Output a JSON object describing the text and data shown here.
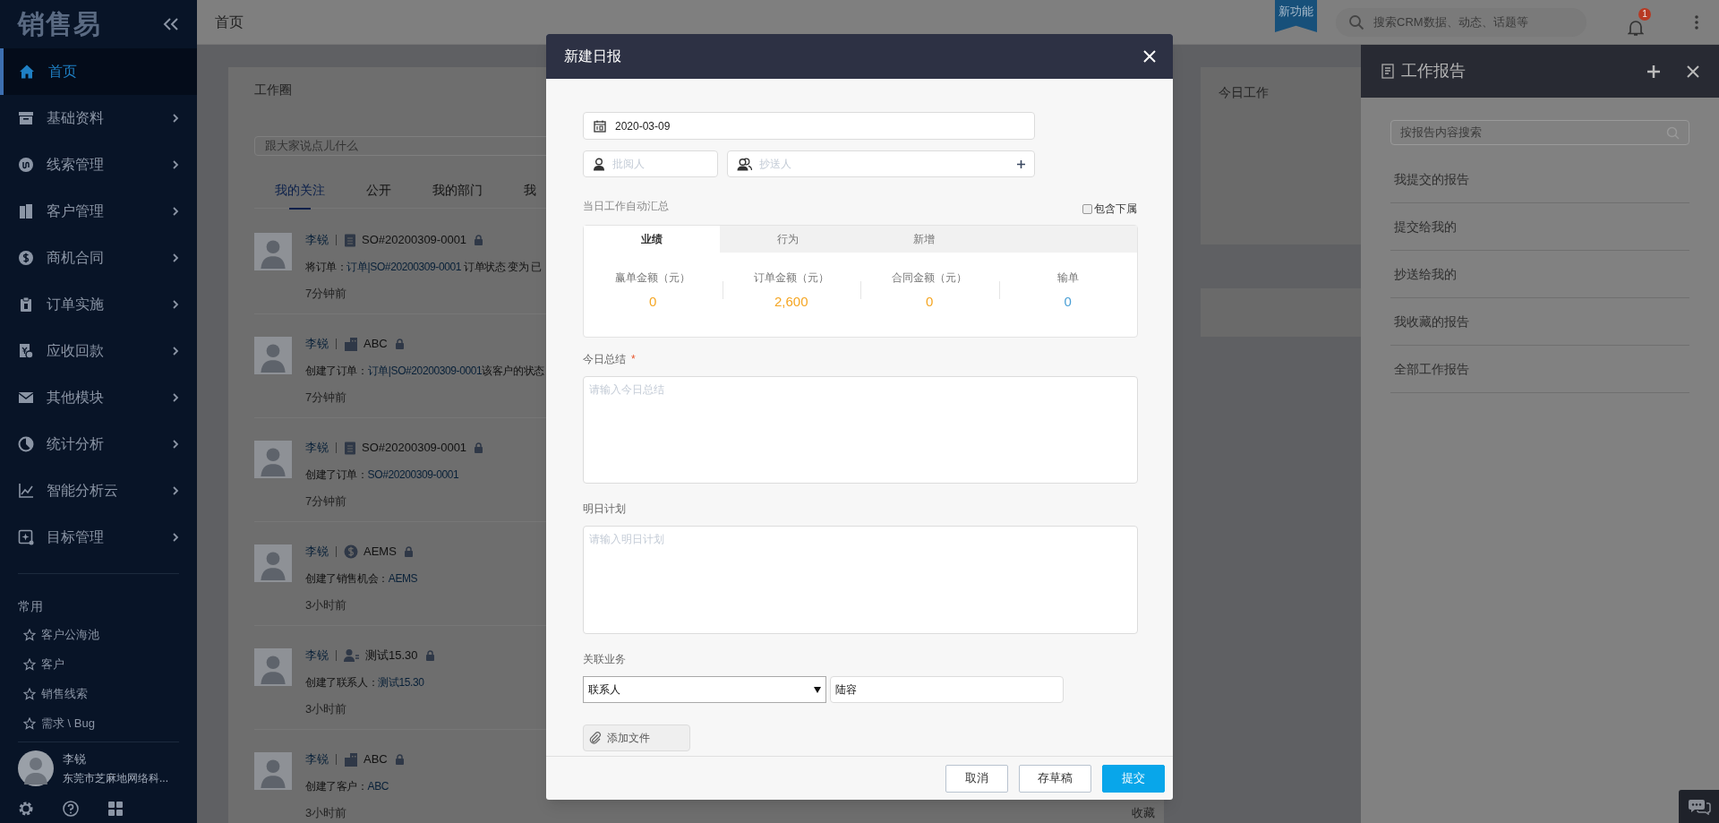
{
  "sidebar": {
    "logo": "销售易",
    "nav": [
      {
        "label": "首页",
        "selected": true,
        "has_submenu": false
      },
      {
        "label": "基础资料",
        "selected": false,
        "has_submenu": true
      },
      {
        "label": "线索管理",
        "selected": false,
        "has_submenu": true
      },
      {
        "label": "客户管理",
        "selected": false,
        "has_submenu": true
      },
      {
        "label": "商机合同",
        "selected": false,
        "has_submenu": true
      },
      {
        "label": "订单实施",
        "selected": false,
        "has_submenu": true
      },
      {
        "label": "应收回款",
        "selected": false,
        "has_submenu": true
      },
      {
        "label": "其他模块",
        "selected": false,
        "has_submenu": true
      },
      {
        "label": "统计分析",
        "selected": false,
        "has_submenu": true
      },
      {
        "label": "智能分析云",
        "selected": false,
        "has_submenu": true
      },
      {
        "label": "目标管理",
        "selected": false,
        "has_submenu": true
      }
    ],
    "favorites_title": "常用",
    "favorites": [
      "客户公海池",
      "客户",
      "销售线索",
      "需求 \\ Bug"
    ],
    "user": {
      "name": "李锐",
      "company": "东莞市芝麻地网络科..."
    }
  },
  "topbar": {
    "title": "首页",
    "ribbon": "新功能",
    "search_placeholder": "搜索CRM数据、动态、话题等",
    "notification_count": "1"
  },
  "feed": {
    "title": "工作圈",
    "composer_placeholder": "跟大家说点儿什么",
    "tabs": [
      {
        "label": "我的关注",
        "selected": true
      },
      {
        "label": "公开",
        "selected": false
      },
      {
        "label": "我的部门",
        "selected": false
      },
      {
        "label": "我",
        "selected": false
      }
    ],
    "posts": [
      {
        "author": "李锐",
        "kind": "order",
        "object": "SO#20200309-0001",
        "locked": true,
        "action": "将订单：",
        "link": "订单|SO#20200309-0001",
        "tail": " 订单状态 变为 已",
        "time": "7分钟前"
      },
      {
        "author": "李锐",
        "kind": "customer",
        "object": "ABC",
        "locked": true,
        "action": "创建了订单：",
        "link": "订单|SO#20200309-0001",
        "tail": "该客户的状态",
        "time": "7分钟前"
      },
      {
        "author": "李锐",
        "kind": "order",
        "object": "SO#20200309-0001",
        "locked": true,
        "action": "创建了订单：",
        "link": "SO#20200309-0001",
        "time": "7分钟前"
      },
      {
        "author": "李锐",
        "kind": "opportunity",
        "object": "AEMS",
        "locked": true,
        "action": "创建了销售机会：",
        "link": "AEMS",
        "time": "3小时前"
      },
      {
        "author": "李锐",
        "kind": "contact",
        "object": "测试15.30",
        "locked": true,
        "action": "创建了联系人：",
        "link": "测试15.30",
        "time": "3小时前"
      },
      {
        "author": "李锐",
        "kind": "customer",
        "object": "ABC",
        "locked": true,
        "action": "创建了客户：",
        "link": "ABC",
        "time": "3小时前",
        "favorite": "收藏"
      }
    ]
  },
  "today_card": {
    "title": "今日工作"
  },
  "dialog": {
    "title": "新建日报",
    "date": "2020-03-09",
    "reviewer_placeholder": "批阅人",
    "cc_placeholder": "抄送人",
    "summary_label": "当日工作自动汇总",
    "include_subordinates": {
      "label": "包含下属",
      "checked": false
    },
    "summary_tabs": [
      {
        "label": "业绩",
        "selected": true
      },
      {
        "label": "行为",
        "selected": false
      },
      {
        "label": "新增",
        "selected": false
      }
    ],
    "stats": [
      {
        "label": "赢单金额（元）",
        "value": "0",
        "color": "#f5a623"
      },
      {
        "label": "订单金额（元）",
        "value": "2,600",
        "color": "#f5a623"
      },
      {
        "label": "合同金额（元）",
        "value": "0",
        "color": "#f5a623"
      },
      {
        "label": "输单",
        "value": "0",
        "color": "#4a9fd5"
      }
    ],
    "today_label": "今日总结",
    "today_mark": "*",
    "today_placeholder": "请输入今日总结",
    "plan_label": "明日计划",
    "plan_placeholder": "请输入明日计划",
    "related_label": "关联业务",
    "related_type": "联系人",
    "related_value": "陆容",
    "attach": "添加文件",
    "buttons": [
      {
        "label": "取消",
        "kind": "default"
      },
      {
        "label": "存草稿",
        "kind": "default"
      },
      {
        "label": "提交",
        "kind": "primary"
      }
    ]
  },
  "report_panel": {
    "title": "工作报告",
    "search_placeholder": "按报告内容搜索",
    "items": [
      "我提交的报告",
      "提交给我的",
      "抄送给我的",
      "我收藏的报告",
      "全部工作报告"
    ]
  }
}
